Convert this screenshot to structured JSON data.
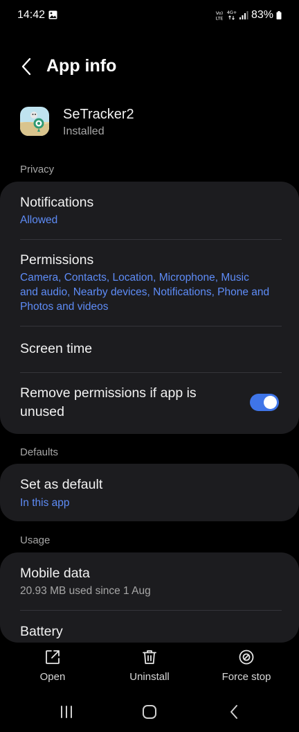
{
  "status_bar": {
    "time": "14:42",
    "battery": "83%",
    "icons": [
      "gallery-icon",
      "volte-icon",
      "4g-icon",
      "signal-icon",
      "battery-icon"
    ]
  },
  "header": {
    "title": "App info",
    "back_icon": "chevron-left-icon"
  },
  "app": {
    "name": "SeTracker2",
    "status": "Installed"
  },
  "sections": {
    "privacy": "Privacy",
    "defaults": "Defaults",
    "usage": "Usage"
  },
  "privacy": {
    "notifications": {
      "title": "Notifications",
      "value": "Allowed"
    },
    "permissions": {
      "title": "Permissions",
      "value_lines": [
        "Camera, Contacts, Location, Microphone, Music",
        "and audio, Nearby devices, Notifications, Phone and",
        "Photos and videos"
      ]
    },
    "screen_time": {
      "title": "Screen time"
    },
    "remove_permissions": {
      "title_lines": [
        "Remove permissions if app is",
        "unused"
      ],
      "enabled": true
    }
  },
  "defaults": {
    "set_default": {
      "title": "Set as default",
      "value": "In this app"
    }
  },
  "usage": {
    "mobile_data": {
      "title": "Mobile data",
      "value": "20.93 MB used since 1 Aug"
    },
    "battery": {
      "title": "Battery"
    }
  },
  "actions": {
    "open": "Open",
    "uninstall": "Uninstall",
    "force_stop": "Force stop"
  },
  "colors": {
    "background": "#000000",
    "card": "#1c1c1f",
    "accent_blue": "#5e8cf7",
    "toggle_on": "#3f75e8",
    "secondary_text": "#a7a7a7"
  }
}
